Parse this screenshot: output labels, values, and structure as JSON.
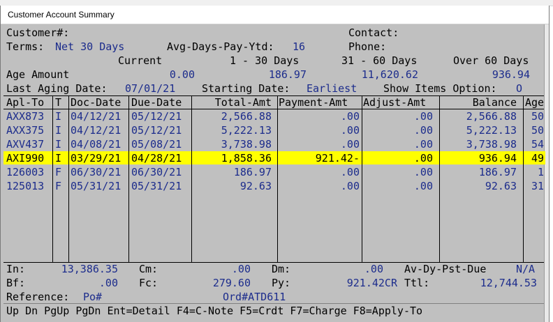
{
  "window": {
    "title": "Customer Account Summary"
  },
  "header": {
    "customer_label": "Customer#:",
    "contact_label": "Contact:",
    "terms_label": "Terms:",
    "terms_value": "Net 30 Days",
    "avg_days_label": "Avg-Days-Pay-Ytd:",
    "avg_days_value": "16",
    "phone_label": "Phone:",
    "aging_headers": [
      "Current",
      "1 - 30 Days",
      "31 - 60 Days",
      "Over 60 Days"
    ],
    "age_amount_label": "Age Amount",
    "age_amounts": [
      "0.00",
      "186.97",
      "11,620.62",
      "936.94"
    ],
    "last_aging_label": "Last Aging Date:",
    "last_aging_value": "07/01/21",
    "starting_date_label": "Starting Date:",
    "starting_date_value": "Earliest",
    "show_items_label": "Show Items Option:",
    "show_items_value": "O"
  },
  "table": {
    "columns": [
      "Apl-To",
      "T",
      "Doc-Date",
      "Due-Date",
      "Total-Amt",
      "Payment-Amt",
      "Adjust-Amt",
      "Balance",
      "Age"
    ],
    "rows": [
      {
        "apl_to": "AXX873",
        "t": "I",
        "doc_date": "04/12/21",
        "due_date": "05/12/21",
        "total": "2,566.88",
        "payment": ".00",
        "adjust": ".00",
        "balance": "2,566.88",
        "age": "50",
        "selected": false
      },
      {
        "apl_to": "AXX375",
        "t": "I",
        "doc_date": "04/12/21",
        "due_date": "05/12/21",
        "total": "5,222.13",
        "payment": ".00",
        "adjust": ".00",
        "balance": "5,222.13",
        "age": "50",
        "selected": false
      },
      {
        "apl_to": "AXV437",
        "t": "I",
        "doc_date": "04/08/21",
        "due_date": "05/08/21",
        "total": "3,738.98",
        "payment": ".00",
        "adjust": ".00",
        "balance": "3,738.98",
        "age": "54",
        "selected": false
      },
      {
        "apl_to": "AXI990",
        "t": "I",
        "doc_date": "03/29/21",
        "due_date": "04/28/21",
        "total": "1,858.36",
        "payment": "921.42-",
        "adjust": ".00",
        "balance": "936.94",
        "age": "49",
        "selected": true
      },
      {
        "apl_to": "126003",
        "t": "F",
        "doc_date": "06/30/21",
        "due_date": "06/30/21",
        "total": "186.97",
        "payment": ".00",
        "adjust": ".00",
        "balance": "186.97",
        "age": "1",
        "selected": false
      },
      {
        "apl_to": "125013",
        "t": "F",
        "doc_date": "05/31/21",
        "due_date": "05/31/21",
        "total": "92.63",
        "payment": ".00",
        "adjust": ".00",
        "balance": "92.63",
        "age": "31",
        "selected": false
      }
    ]
  },
  "footer": {
    "in_label": "In:",
    "in_value": "13,386.35",
    "cm_label": "Cm:",
    "cm_value": ".00",
    "dm_label": "Dm:",
    "dm_value": ".00",
    "av_dy_label": "Av-Dy-Pst-Due",
    "av_dy_value": "N/A",
    "bf_label": "Bf:",
    "bf_value": ".00",
    "fc_label": "Fc:",
    "fc_value": "279.60",
    "py_label": "Py:",
    "py_value": "921.42CR",
    "ttl_label": "Ttl:",
    "ttl_value": "12,744.53",
    "reference_label": "Reference:",
    "reference_value": "Po#",
    "order_value": "Ord#ATD611",
    "keys": "Up Dn PgUp PgDn Ent=Detail F4=C-Note F5=Crdt F7=Charge F8=Apply-To"
  }
}
